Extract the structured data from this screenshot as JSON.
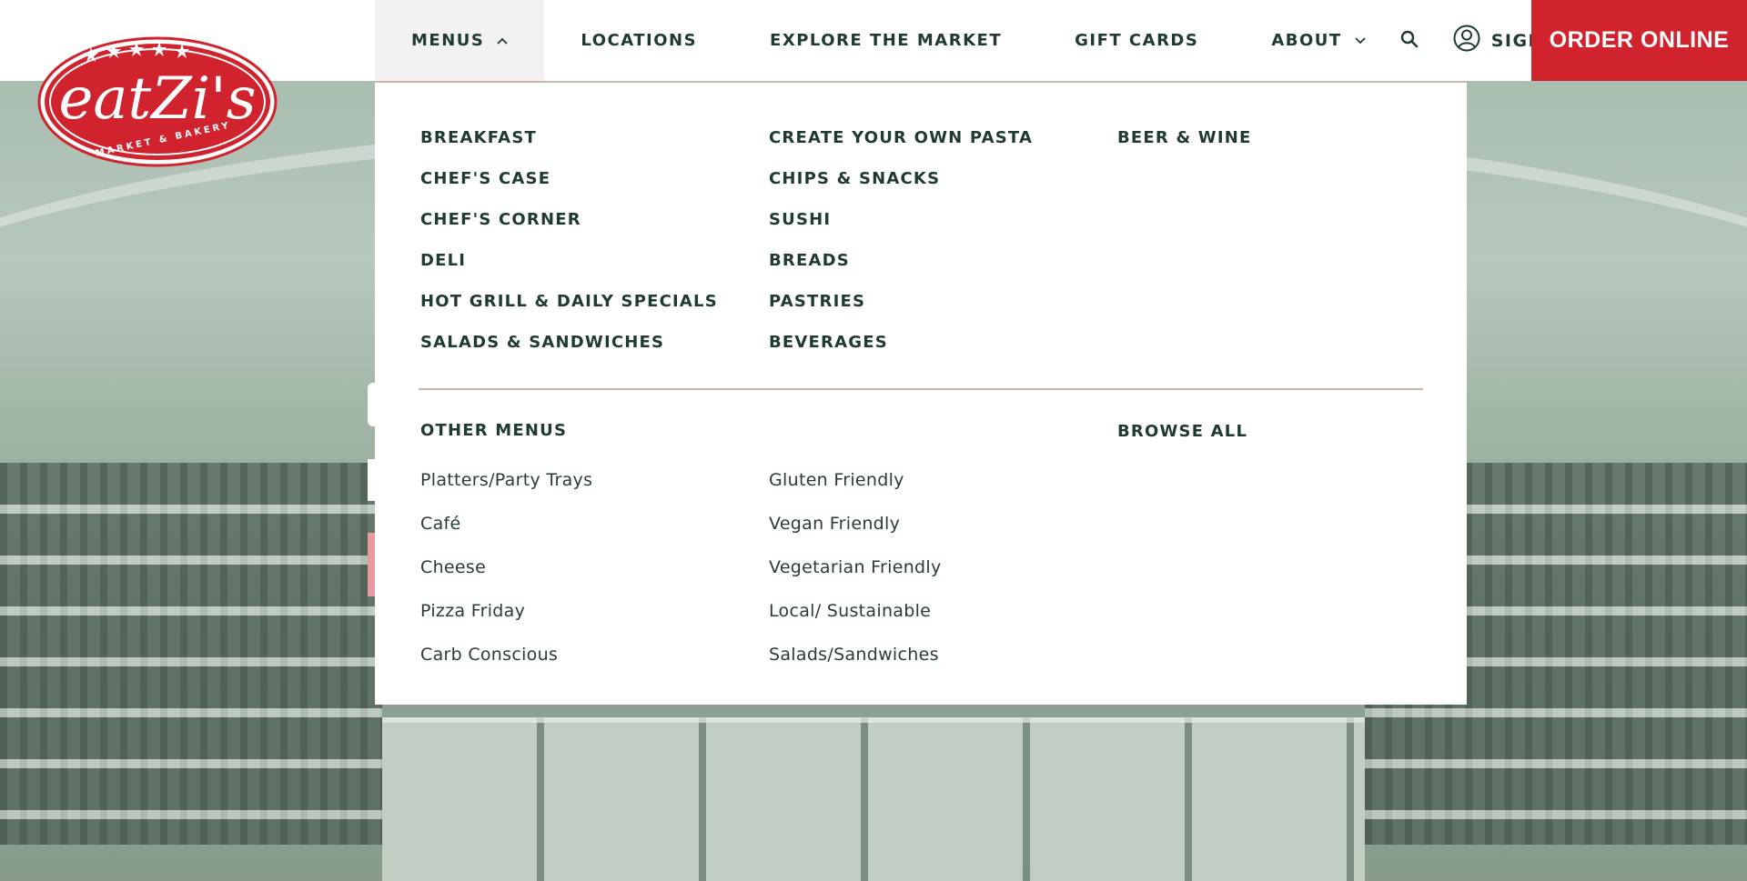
{
  "brand": {
    "name": "eatZi's",
    "tagline": "MARKET & BAKERY",
    "colors": {
      "primary_red": "#d1232e",
      "text_green": "#1f3b2e",
      "divider": "#c9b6a6"
    }
  },
  "nav": {
    "items": [
      {
        "label": "MENUS",
        "icon": "chevron-up-icon",
        "active": true
      },
      {
        "label": "LOCATIONS"
      },
      {
        "label": "EXPLORE THE MARKET"
      },
      {
        "label": "GIFT CARDS"
      },
      {
        "label": "ABOUT",
        "icon": "chevron-down-icon"
      }
    ],
    "search_icon": "search-icon",
    "sign_in": {
      "label": "SIGN IN",
      "icon": "user-circle-icon"
    },
    "order_online": "ORDER ONLINE"
  },
  "menus_dropdown": {
    "columns": [
      [
        "BREAKFAST",
        "CHEF'S CASE",
        "CHEF'S CORNER",
        "DELI",
        "HOT GRILL & DAILY SPECIALS",
        "SALADS & SANDWICHES"
      ],
      [
        "CREATE YOUR OWN PASTA",
        "CHIPS & SNACKS",
        "SUSHI",
        "BREADS",
        "PASTRIES",
        "BEVERAGES"
      ],
      [
        "BEER & WINE"
      ]
    ],
    "other_menus_title": "OTHER MENUS",
    "browse_all": "BROWSE ALL",
    "other_menus": [
      [
        "Platters/Party Trays",
        "Café",
        "Cheese",
        "Pizza Friday",
        "Carb Conscious"
      ],
      [
        "Gluten Friendly",
        "Vegan Friendly",
        "Vegetarian Friendly",
        "Local/ Sustainable",
        "Salads/Sandwiches"
      ]
    ]
  }
}
